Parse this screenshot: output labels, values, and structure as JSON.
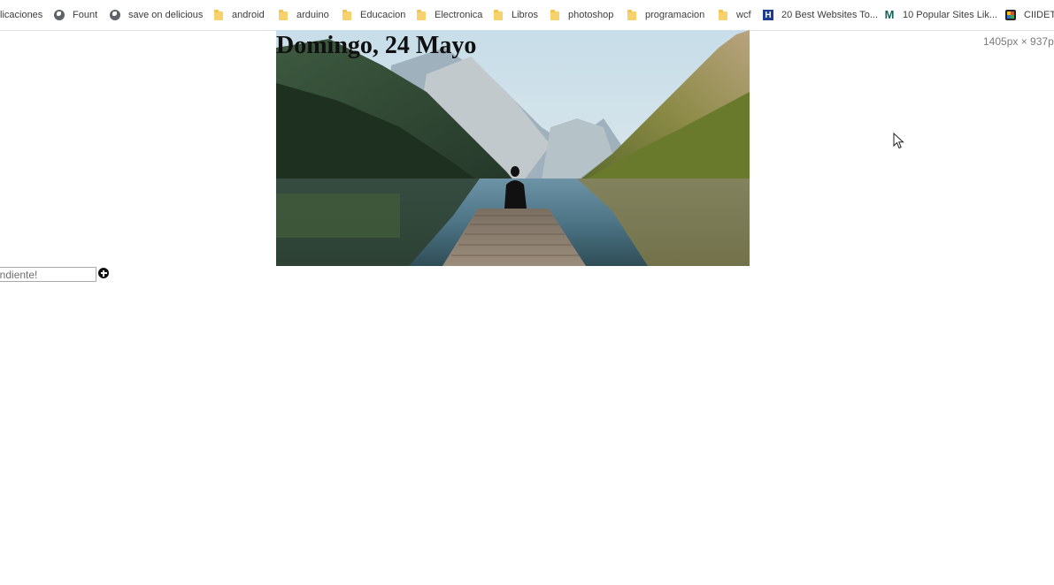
{
  "bookmarks": [
    {
      "label": "licaciones",
      "icon": "apps-icon"
    },
    {
      "label": "Fount",
      "icon": "globe-icon"
    },
    {
      "label": "save on delicious",
      "icon": "globe-icon"
    },
    {
      "label": "android",
      "icon": "folder-icon"
    },
    {
      "label": "arduino",
      "icon": "folder-icon"
    },
    {
      "label": "Educacion",
      "icon": "folder-icon"
    },
    {
      "label": "Electronica",
      "icon": "folder-icon"
    },
    {
      "label": "Libros",
      "icon": "folder-icon"
    },
    {
      "label": "photoshop",
      "icon": "folder-icon"
    },
    {
      "label": "programacion",
      "icon": "folder-icon"
    },
    {
      "label": "wcf",
      "icon": "folder-icon"
    },
    {
      "label": "20 Best Websites To...",
      "icon": "h-site-icon"
    },
    {
      "label": "10 Popular Sites Lik...",
      "icon": "m-site-icon"
    },
    {
      "label": "CIIDET",
      "icon": "ciidet-icon"
    }
  ],
  "page": {
    "viewport_size": "1405px × 937p",
    "date_title": "Domingo, 24 Mayo",
    "task_input_placeholder": "endiente!",
    "hero_image": "lake-mountain-dock-photo"
  },
  "icons": {
    "add_button": "plus-circle-icon",
    "cursor": "mouse-pointer-icon"
  }
}
